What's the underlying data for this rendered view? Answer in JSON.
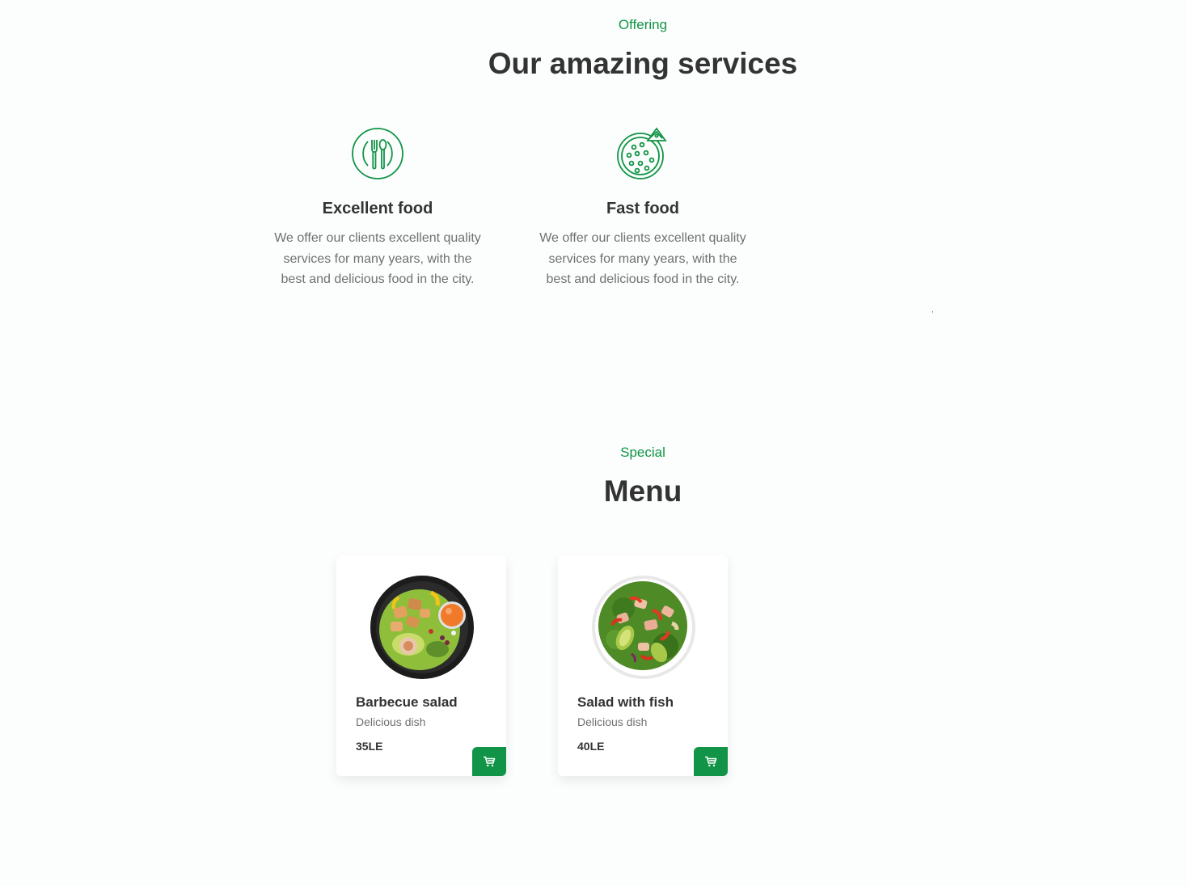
{
  "colors": {
    "accent": "#119447",
    "heading": "#333333",
    "body_text": "#707070",
    "background": "#fbfefc"
  },
  "services_section": {
    "subtitle": "Offering",
    "title": "Our amazing services",
    "items": [
      {
        "icon": "utensils-plate-icon",
        "title": "Excellent food",
        "description": "We offer our clients excellent quality services for many years, with the best and delicious food in the city."
      },
      {
        "icon": "pizza-icon",
        "title": "Fast food",
        "description": "We offer our clients excellent quality services for many years, with the best and delicious food in the city."
      }
    ]
  },
  "menu_section": {
    "subtitle": "Special",
    "title": "Menu",
    "items": [
      {
        "image": "barbecue-salad-image",
        "name": "Barbecue salad",
        "description": "Delicious dish",
        "price": "35LE",
        "button_icon": "cart-icon"
      },
      {
        "image": "salad-with-fish-image",
        "name": "Salad with fish",
        "description": "Delicious dish",
        "price": "40LE",
        "button_icon": "cart-icon"
      }
    ]
  }
}
